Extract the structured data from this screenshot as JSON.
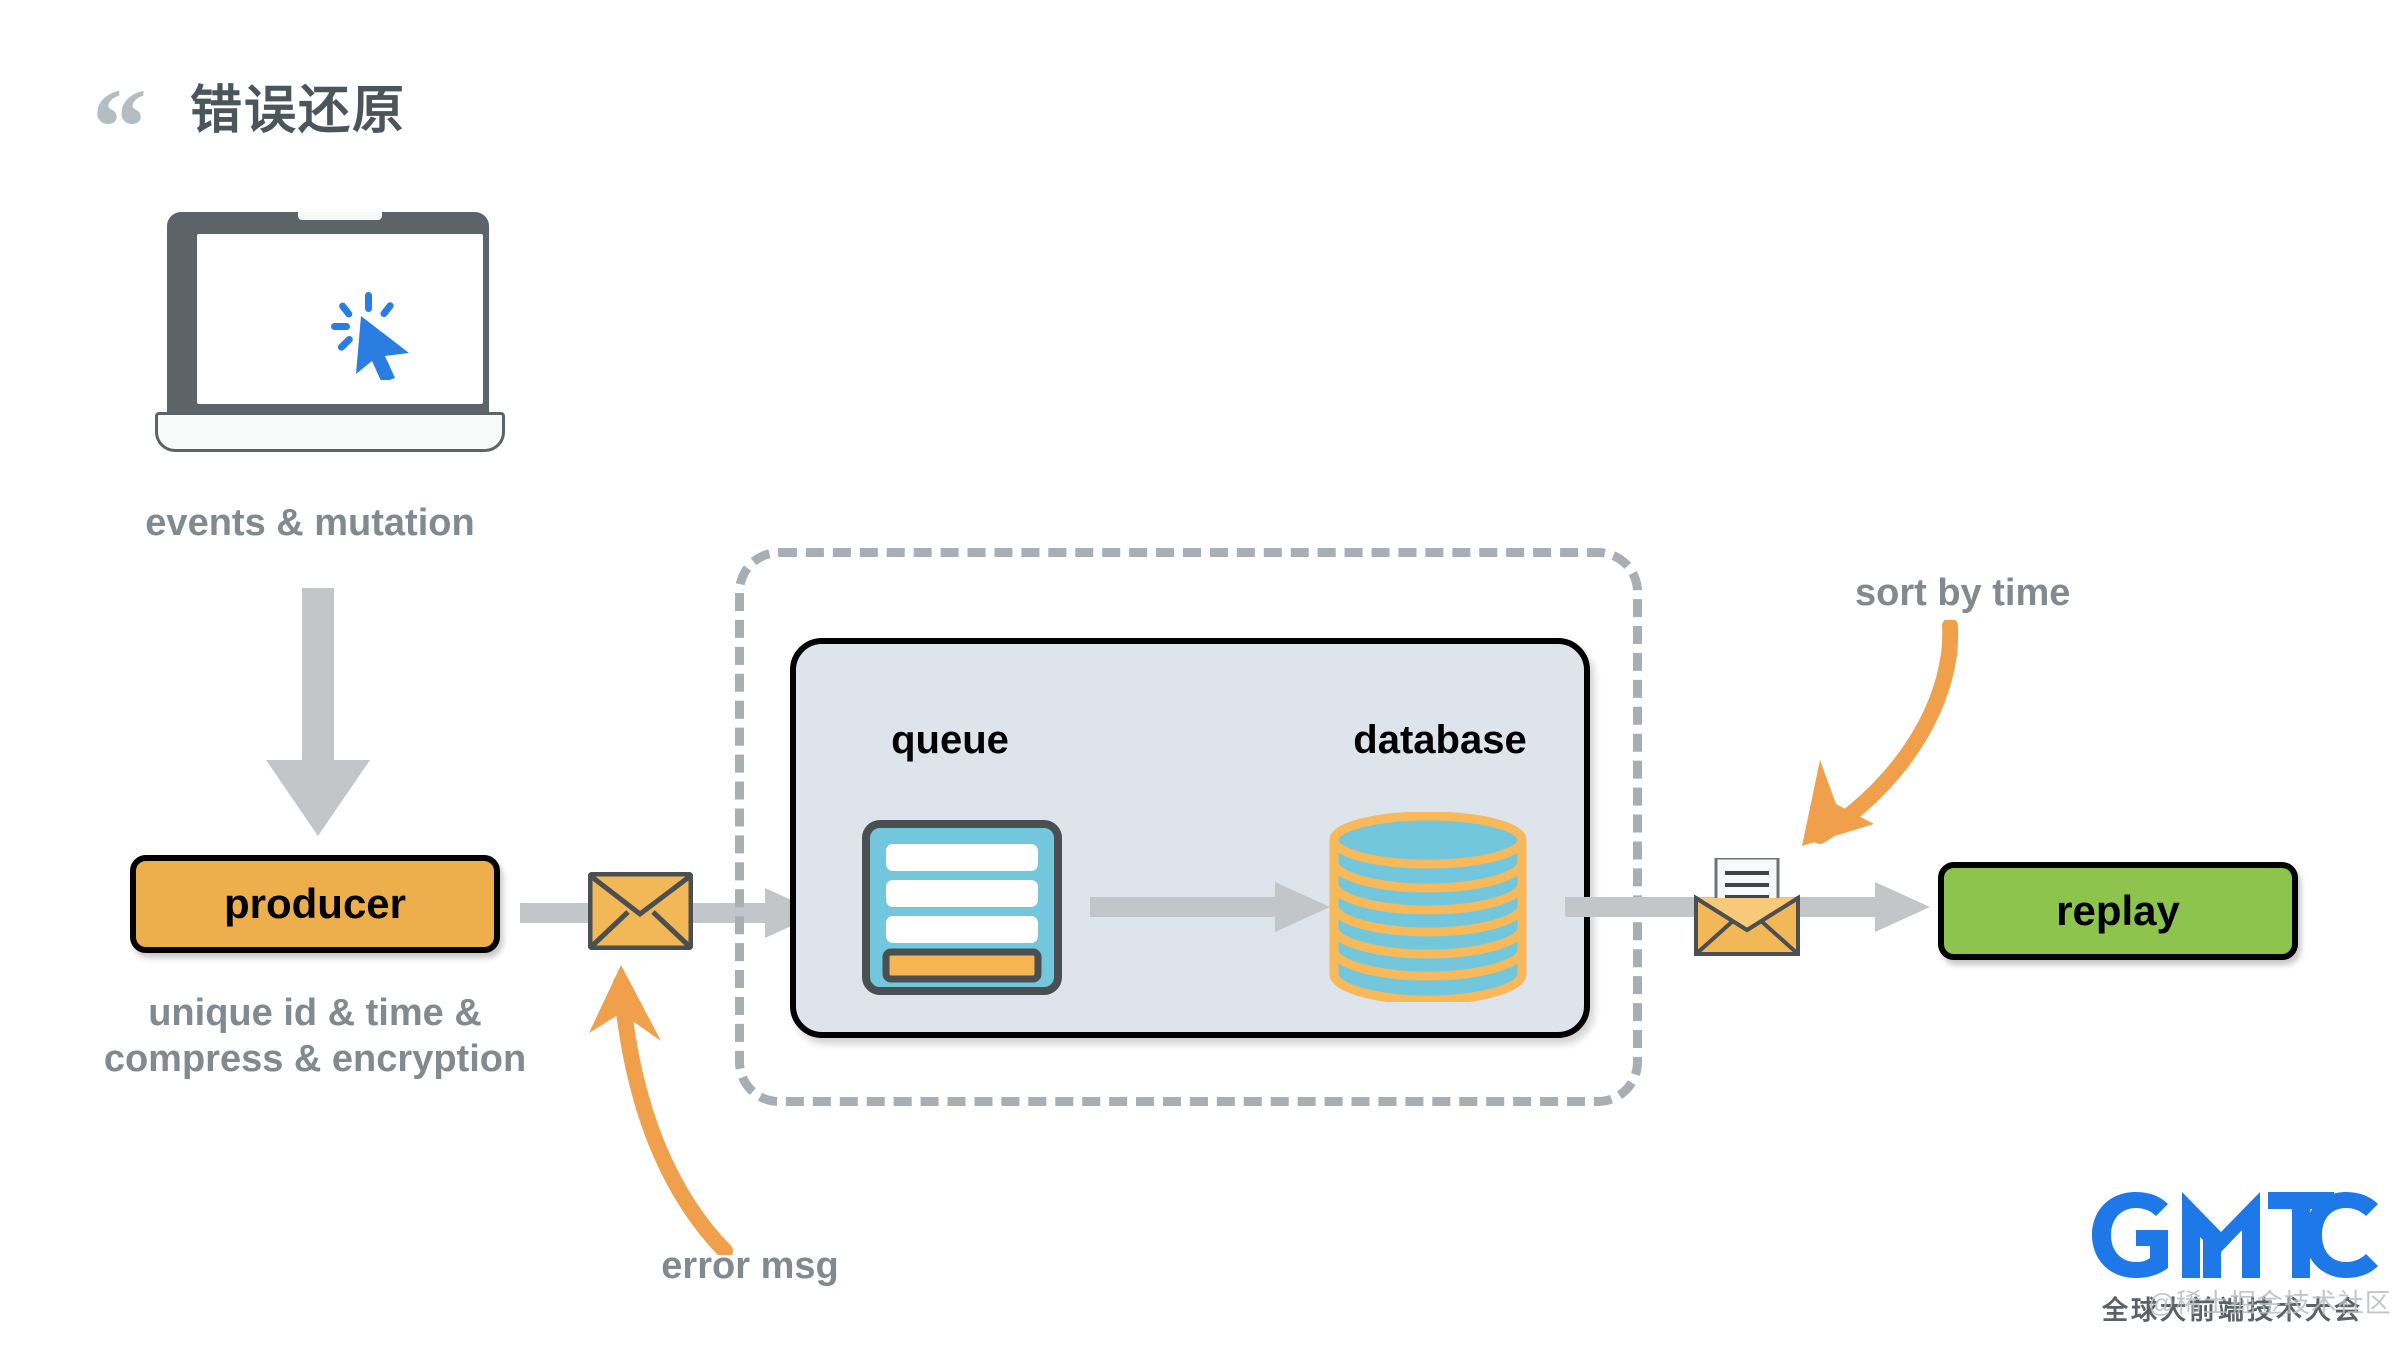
{
  "slide": {
    "title": "错误还原",
    "quote_glyph": "“"
  },
  "nodes": {
    "producer": "producer",
    "replay": "replay",
    "queue": "queue",
    "database": "database"
  },
  "annotations": {
    "events_mutation": "events & mutation",
    "producer_detail": "unique id & time & compress & encryption",
    "error_msg": "error  msg",
    "sort_by_time": "sort by time"
  },
  "icons": {
    "laptop": "laptop-icon",
    "cursor": "cursor-click-icon",
    "queue": "queue-list-icon",
    "database": "database-cylinder-icon",
    "envelope_closed": "envelope-closed-icon",
    "envelope_open": "envelope-open-icon",
    "down_arrow": "down-arrow-icon",
    "flow_arrow": "right-arrow-icon",
    "curve_arrow_up": "curved-arrow-up-left-icon",
    "curve_arrow_down": "curved-arrow-down-left-icon"
  },
  "branding": {
    "logo_text": "GMTC",
    "logo_subtitle": "全球大前端技术大会",
    "watermark": "@稀土掘金技术社区"
  },
  "colors": {
    "producer_fill": "#ecaf4c",
    "replay_fill": "#8cc44e",
    "panel_fill": "#dde4ec",
    "queue_body": "#72c7dd",
    "queue_highlight": "#f5b553",
    "db_band": "#f7b95a",
    "db_fill": "#72c7dd",
    "arrow_gray": "#c3c6c8",
    "annotation_orange": "#f0a04b",
    "label_gray": "#808a90",
    "title_gray": "#4b555c",
    "logo_blue": "#1f78e8",
    "dashed_gray": "#a7aeb4",
    "laptop_gray": "#5c6468",
    "cursor_blue": "#2a7de1"
  }
}
